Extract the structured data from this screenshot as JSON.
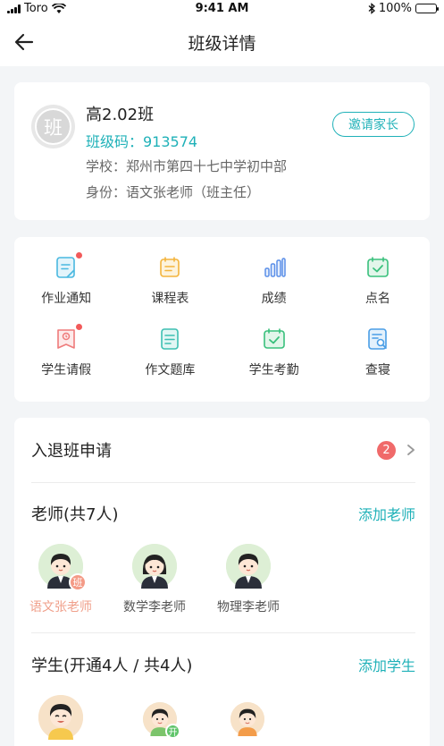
{
  "status_bar": {
    "carrier": "Toro",
    "time": "9:41 AM",
    "battery": "100%"
  },
  "navbar": {
    "title": "班级详情"
  },
  "class_info": {
    "avatar_text": "班",
    "name": "高2.02班",
    "code": "班级码：913574",
    "school": "学校：郑州市第四十七中学初中部",
    "role": "身份：语文张老师（班主任）",
    "invite_label": "邀请家长"
  },
  "functions": [
    {
      "label": "作业通知",
      "icon": "homework-notice-icon",
      "dot": true
    },
    {
      "label": "课程表",
      "icon": "schedule-icon",
      "dot": false
    },
    {
      "label": "成绩",
      "icon": "grades-icon",
      "dot": false
    },
    {
      "label": "点名",
      "icon": "rollcall-icon",
      "dot": false
    },
    {
      "label": "学生请假",
      "icon": "leave-request-icon",
      "dot": true
    },
    {
      "label": "作文题库",
      "icon": "essay-bank-icon",
      "dot": false
    },
    {
      "label": "学生考勤",
      "icon": "attendance-icon",
      "dot": false
    },
    {
      "label": "查寝",
      "icon": "dorm-check-icon",
      "dot": false
    }
  ],
  "applications": {
    "label": "入退班申请",
    "count": "2"
  },
  "teachers": {
    "title": "老师(共7人)",
    "action": "添加老师",
    "members": [
      {
        "name": "语文张老师",
        "tag": "班",
        "active": true
      },
      {
        "name": "数学李老师",
        "tag": "",
        "active": false
      },
      {
        "name": "物理李老师",
        "tag": "",
        "active": false
      }
    ]
  },
  "students": {
    "title": "学生(开通4人 / 共4人)",
    "action": "添加学生",
    "members": [
      {
        "name": "",
        "tag": ""
      },
      {
        "name": "",
        "tag": "开"
      },
      {
        "name": "",
        "tag": ""
      }
    ]
  },
  "colors": {
    "accent": "#1fb1b8",
    "badge": "#f06a6a",
    "highlight": "#f0a08b"
  }
}
